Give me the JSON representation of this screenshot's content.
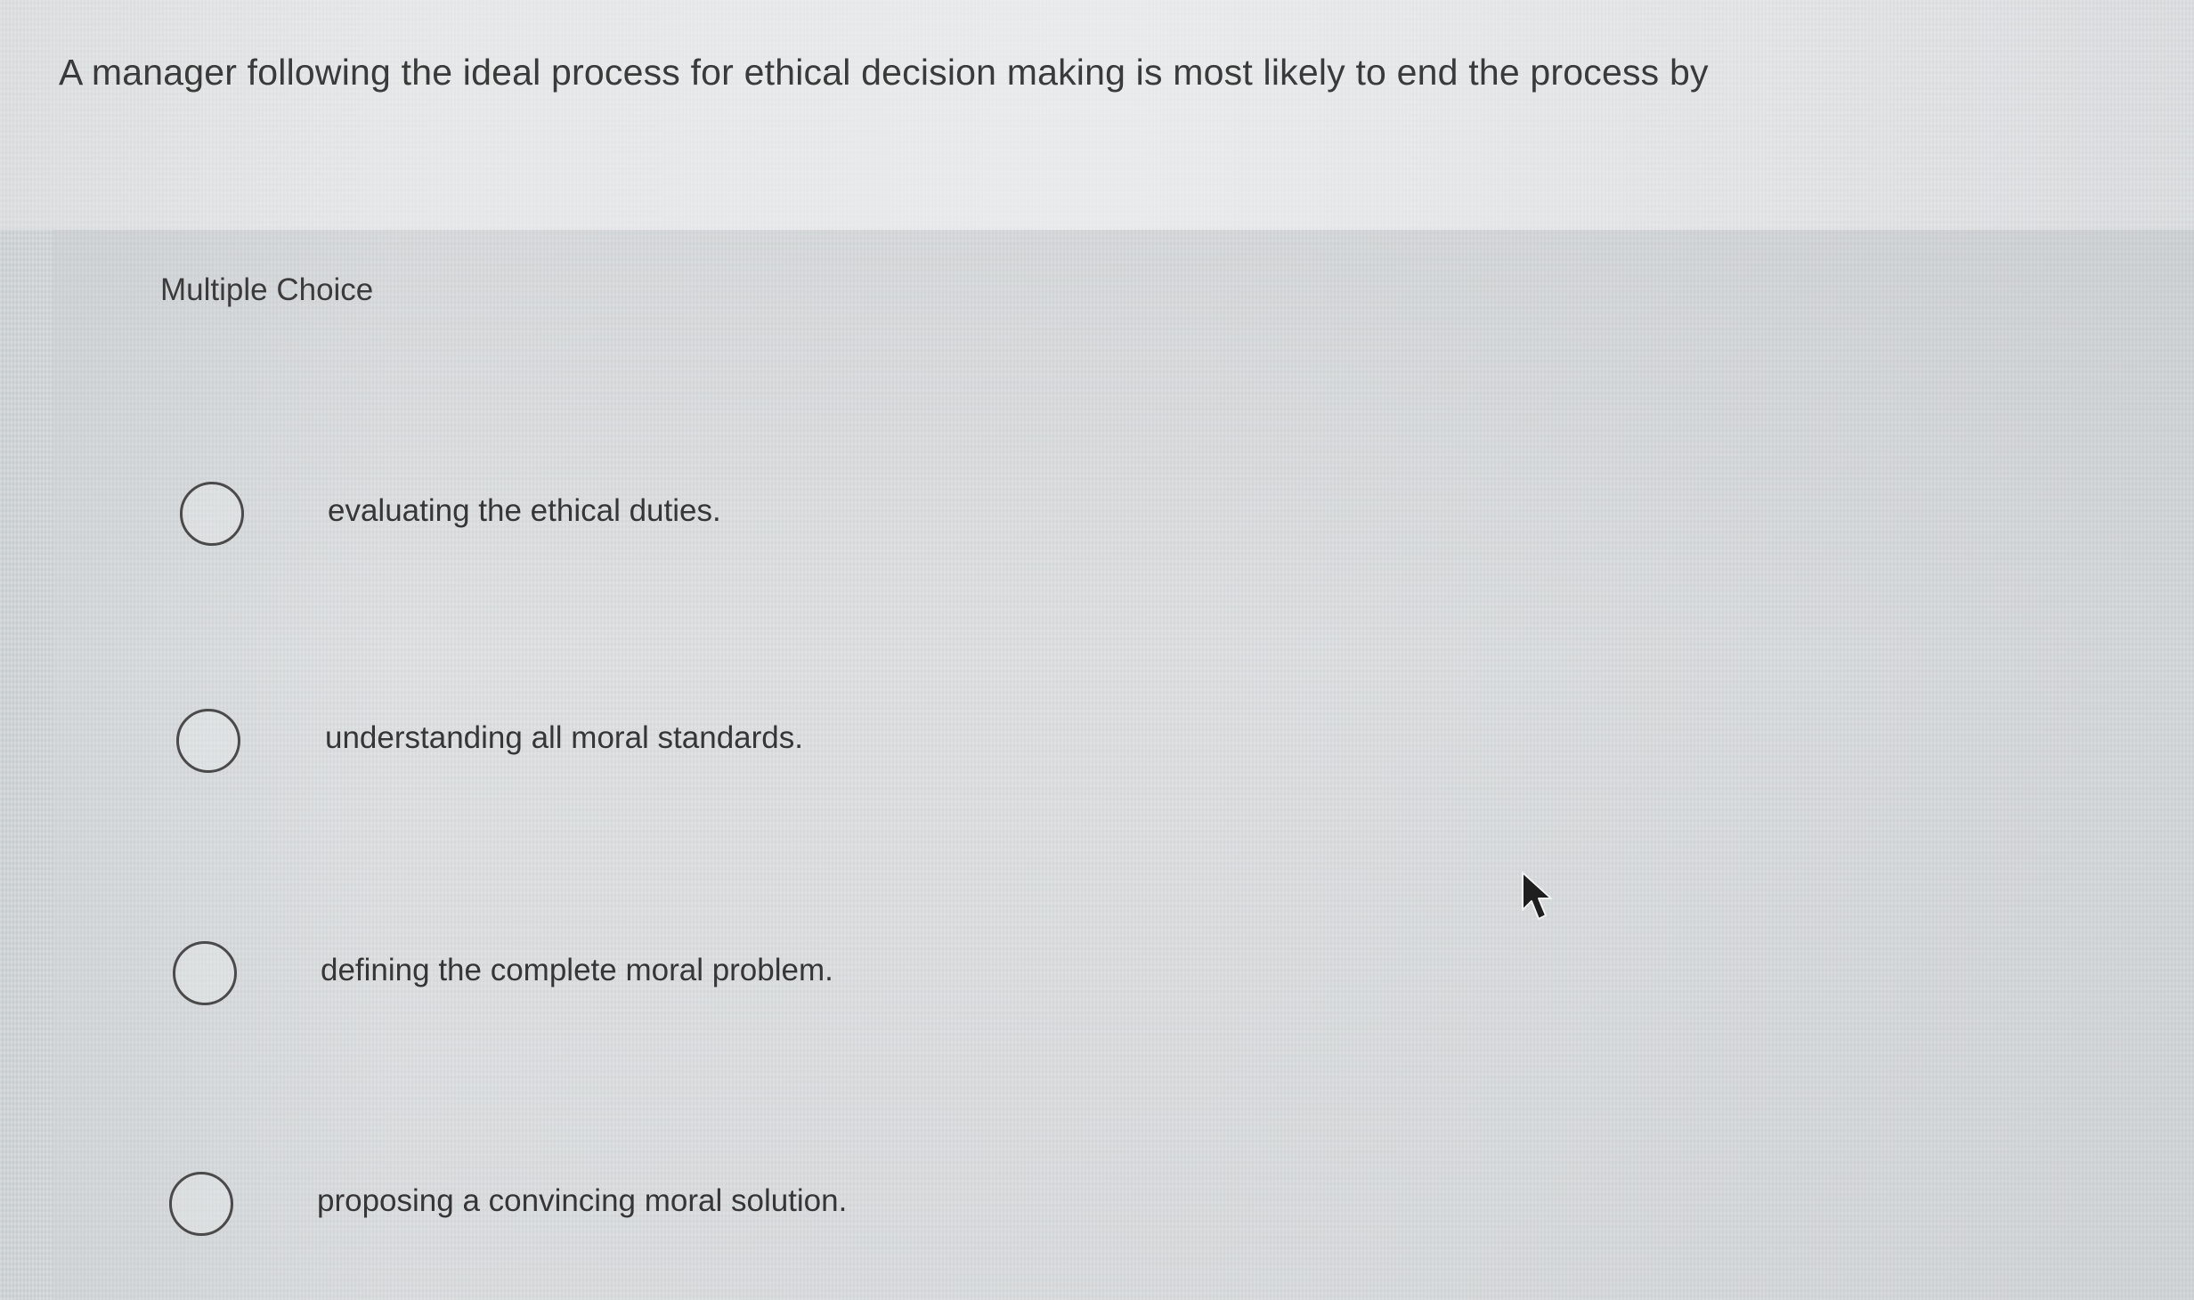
{
  "question": {
    "text": "A manager following the ideal process for ethical decision making is most likely to end the process by"
  },
  "answer_section": {
    "type_label": "Multiple Choice",
    "options": [
      {
        "label": "evaluating the ethical duties.",
        "selected": false
      },
      {
        "label": "understanding all moral standards.",
        "selected": false
      },
      {
        "label": "defining the complete moral problem.",
        "selected": false
      },
      {
        "label": "proposing a convincing moral solution.",
        "selected": false
      }
    ]
  },
  "pointer": {
    "icon": "mouse-pointer-icon"
  }
}
